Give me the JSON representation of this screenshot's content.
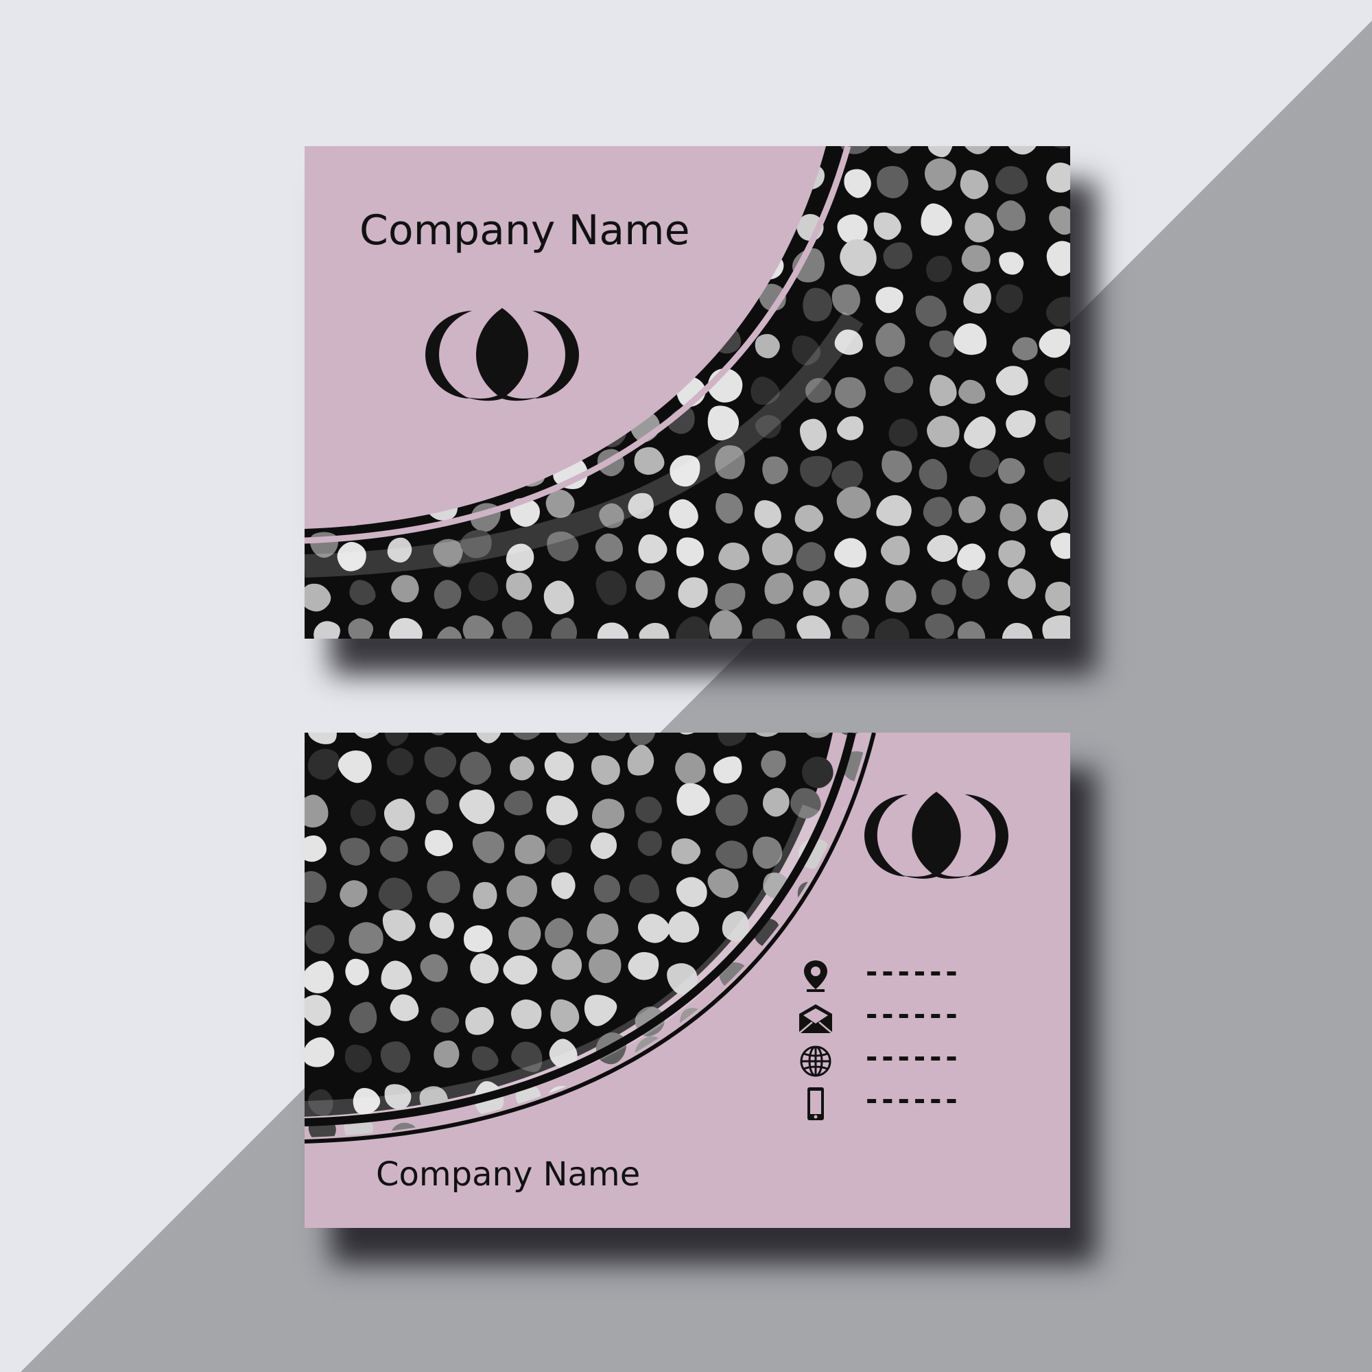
{
  "colors": {
    "card_pink": "#cfb4c6",
    "mosaic_bg": "#0d0d0d",
    "page_light": "#e6e7ec",
    "page_dark": "#a5a6aa",
    "ink": "#111111"
  },
  "front": {
    "company_name": "Company Name",
    "logo_icon": "crescent-leaf-logo-icon"
  },
  "back": {
    "company_name": "Company Name",
    "logo_icon": "crescent-leaf-logo-icon",
    "contacts": [
      {
        "icon": "location-pin-icon",
        "value": "------"
      },
      {
        "icon": "envelope-icon",
        "value": "------"
      },
      {
        "icon": "globe-icon",
        "value": "------"
      },
      {
        "icon": "mobile-phone-icon",
        "value": "------"
      }
    ]
  }
}
